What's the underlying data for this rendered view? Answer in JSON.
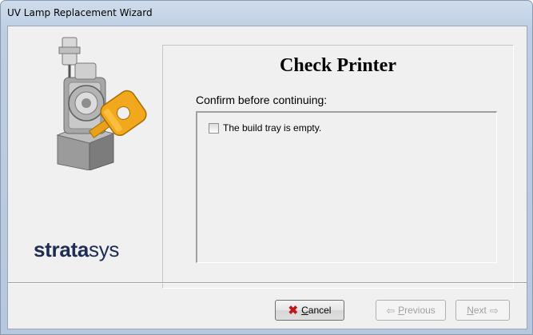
{
  "window": {
    "title": "UV Lamp Replacement Wizard"
  },
  "brand": {
    "logo_bold": "strata",
    "logo_light": "sys"
  },
  "page": {
    "title": "Check Printer",
    "instruction": "Confirm before continuing:",
    "checklist": [
      {
        "label": "The build tray is empty.",
        "checked": false
      }
    ]
  },
  "buttons": {
    "cancel": {
      "mnemonic": "C",
      "rest": "ancel",
      "icon": "red-x-icon",
      "enabled": true
    },
    "previous": {
      "mnemonic": "P",
      "rest": "revious",
      "icon": "arrow-left-icon",
      "enabled": false
    },
    "next": {
      "mnemonic": "N",
      "rest": "ext",
      "icon": "arrow-right-icon",
      "enabled": false
    }
  },
  "colors": {
    "logo": "#1f2d54",
    "key_tag": "#f1a81d",
    "cancel_x": "#c0161a",
    "window_frame": "#bccde3"
  }
}
